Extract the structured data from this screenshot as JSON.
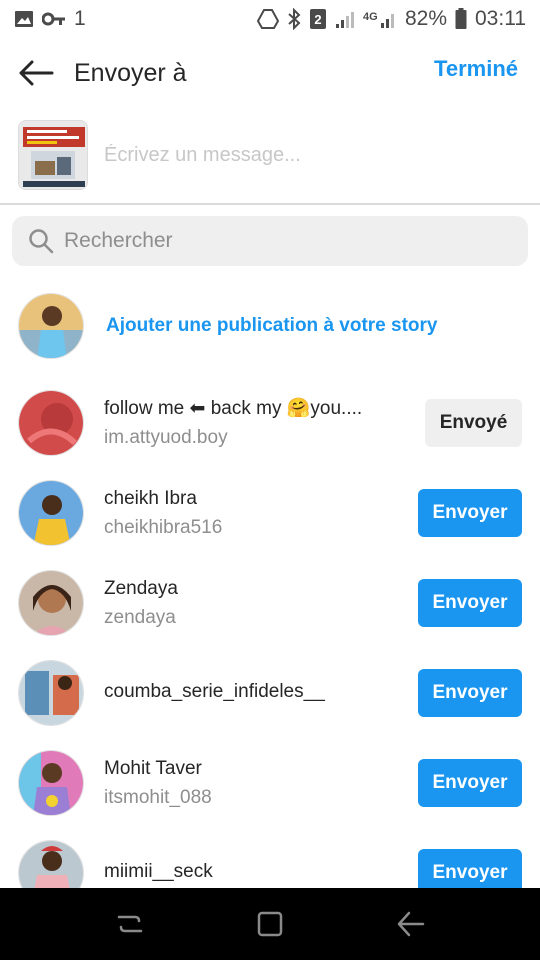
{
  "status_bar": {
    "battery": "82%",
    "time": "03:11",
    "network": "4G",
    "sim_badge": "2",
    "left_indicator": "1"
  },
  "header": {
    "title": "Envoyer à",
    "done_label": "Terminé"
  },
  "composer": {
    "placeholder": "Écrivez un message..."
  },
  "search": {
    "placeholder": "Rechercher"
  },
  "story": {
    "label": "Ajouter une publication à votre story"
  },
  "contacts": [
    {
      "name": "follow me ⬅ back my 🤗you....",
      "username": "im.attyuod.boy",
      "action": "Envoyé",
      "state": "sent"
    },
    {
      "name": "cheikh Ibra",
      "username": "cheikhibra516",
      "action": "Envoyer",
      "state": "send"
    },
    {
      "name": "Zendaya",
      "username": "zendaya",
      "action": "Envoyer",
      "state": "send"
    },
    {
      "name": "coumba_serie_infideles__",
      "username": "",
      "action": "Envoyer",
      "state": "send"
    },
    {
      "name": "Mohit Taver",
      "username": "itsmohit_088",
      "action": "Envoyer",
      "state": "send"
    },
    {
      "name": "miimii__seck",
      "username": "",
      "action": "Envoyer",
      "state": "send"
    }
  ],
  "colors": {
    "accent": "#1a96f0",
    "secondary_text": "#8e8e8e",
    "sent_button_bg": "#efefef"
  }
}
